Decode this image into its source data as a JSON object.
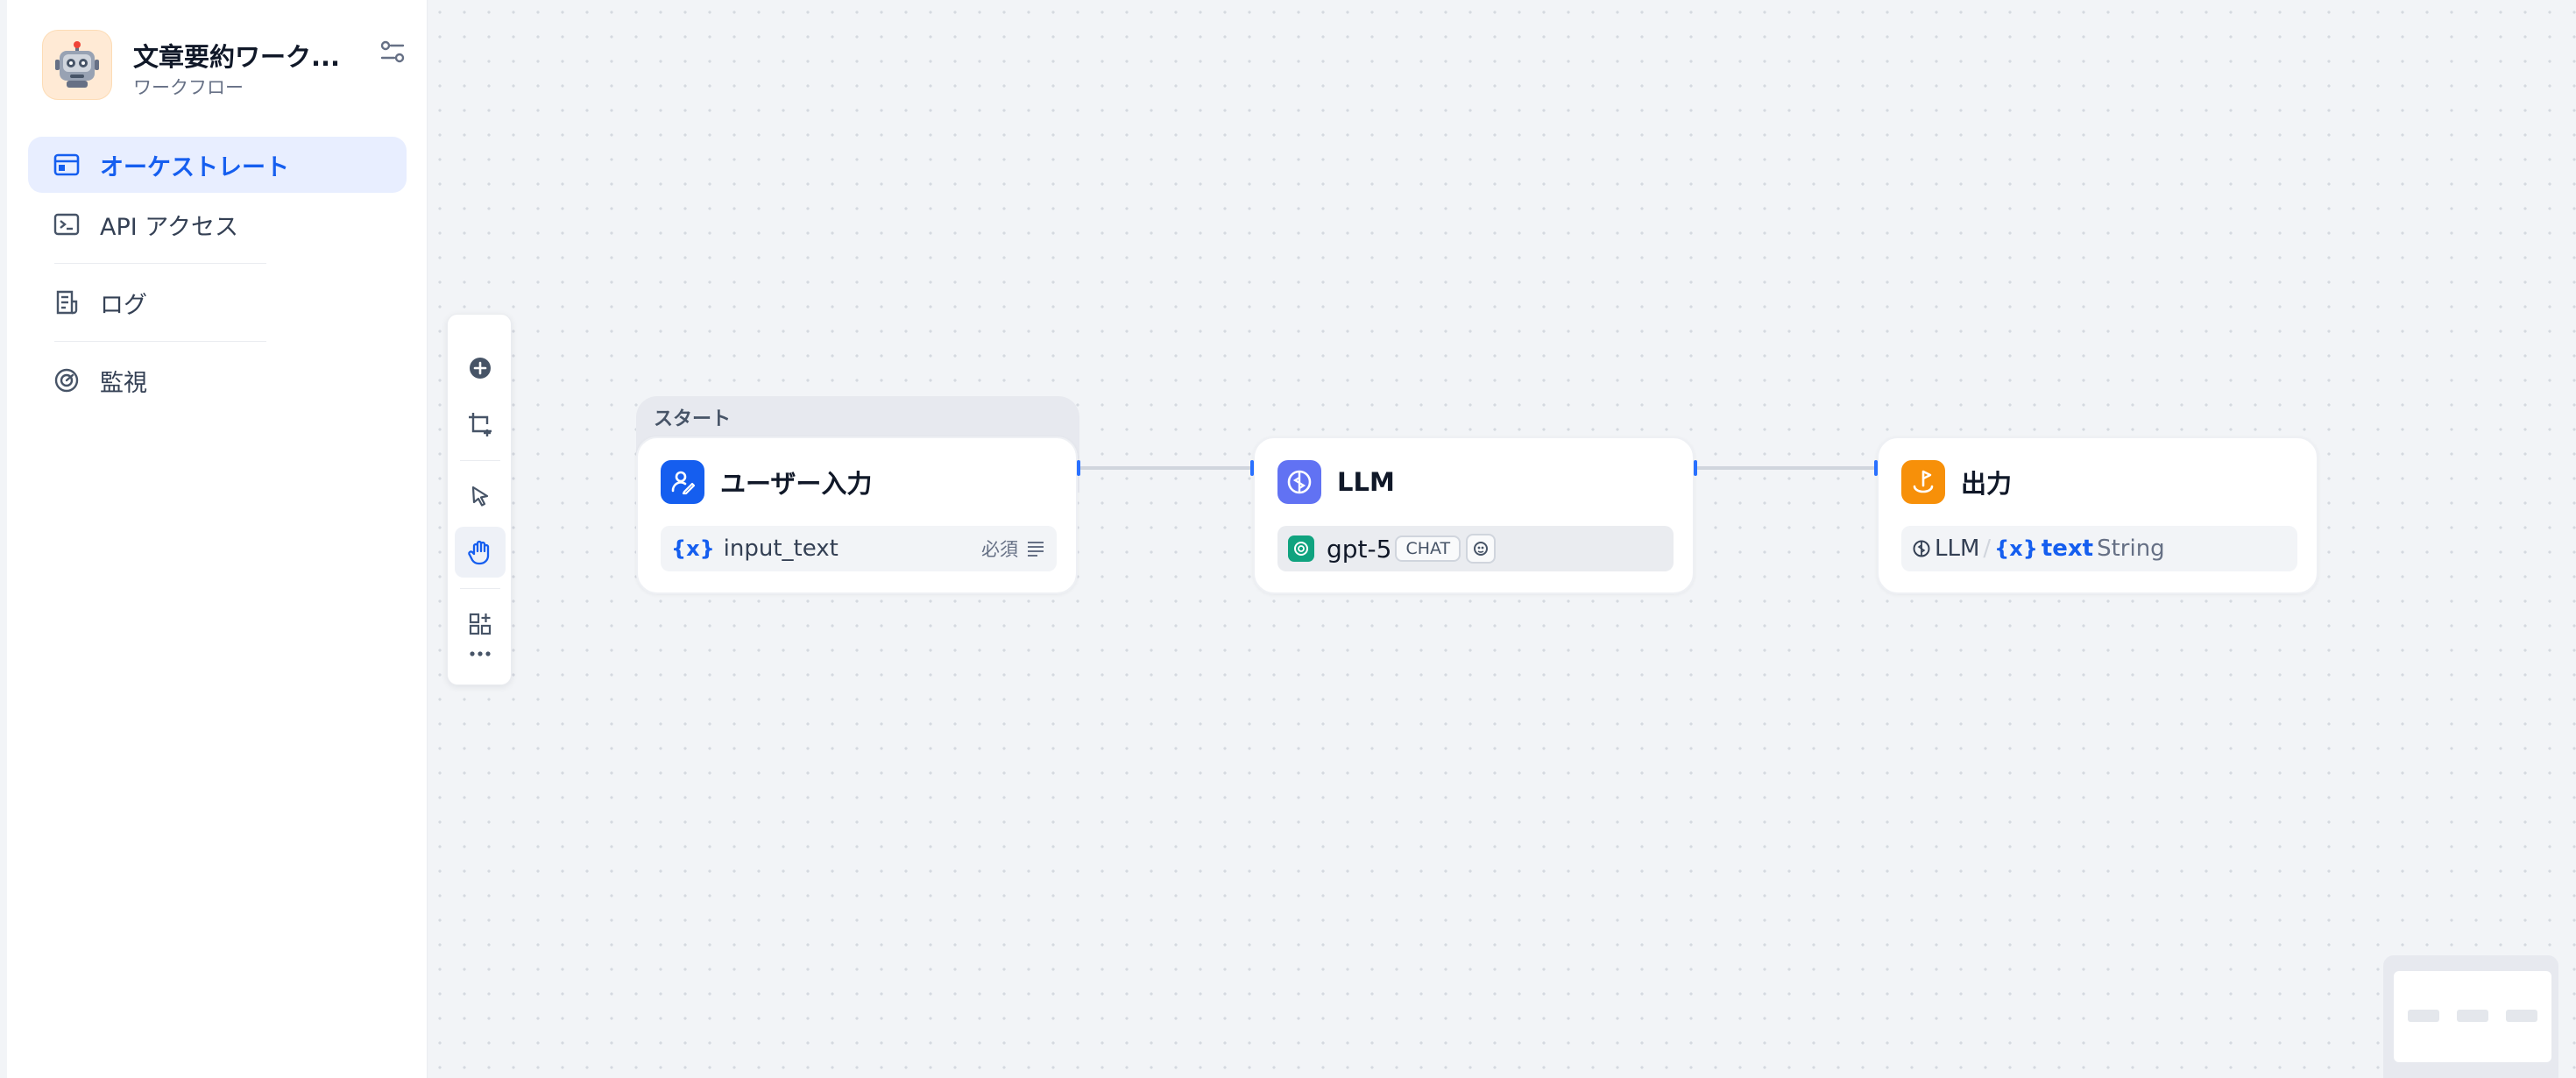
{
  "app": {
    "title": "文章要約ワーク...",
    "subtitle": "ワークフロー",
    "icon": "robot-emoji"
  },
  "nav": {
    "items": [
      {
        "label": "オーケストレート",
        "icon": "workflow-icon",
        "active": true
      },
      {
        "label": "API アクセス",
        "icon": "terminal-icon",
        "active": false
      },
      {
        "label": "ログ",
        "icon": "log-file-icon",
        "active": false
      },
      {
        "label": "監視",
        "icon": "gauge-icon",
        "active": false
      }
    ]
  },
  "toolbar": {
    "tools": [
      "add-node-icon",
      "add-note-icon",
      "pointer-icon",
      "hand-icon",
      "organize-blocks-icon",
      "more-icon"
    ],
    "active_tool": "hand-icon"
  },
  "nodes": {
    "start": {
      "group_label": "スタート",
      "title": "ユーザー入力",
      "field_name": "input_text",
      "var_icon": "{x}",
      "required_label": "必須",
      "icon_color": "#155eef"
    },
    "llm": {
      "title": "LLM",
      "model": "gpt-5",
      "mode_tag": "CHAT",
      "icon_color": "#6172f3"
    },
    "output": {
      "title": "出力",
      "source_node": "LLM",
      "separator": "/",
      "var_icon": "{x}",
      "var_name": "text",
      "var_type": "String",
      "icon_color": "#f79009"
    }
  },
  "colors": {
    "accent": "#155eef",
    "handle": "#2970ff",
    "edge": "#d0d5dd"
  }
}
